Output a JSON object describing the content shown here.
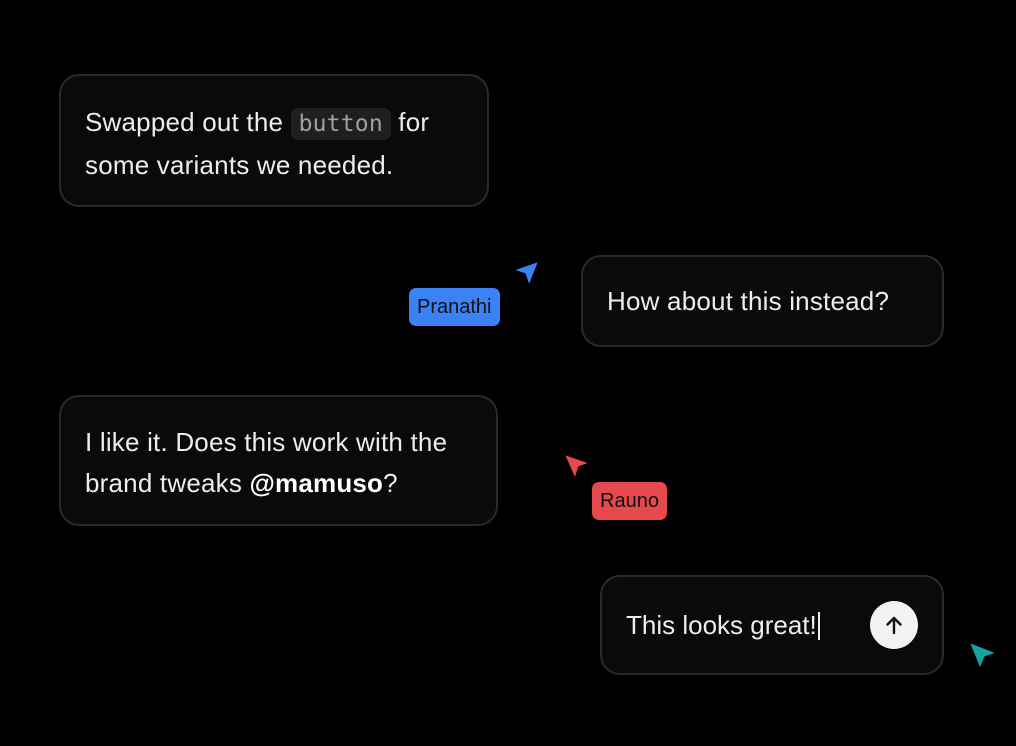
{
  "messages": [
    {
      "before_code": "Swapped out the ",
      "code": "button",
      "after_code": " for some variants we needed."
    },
    {
      "text": "How about this instead?"
    },
    {
      "before_mention": "I like it. Does this work with the brand tweaks ",
      "mention": "@mamuso",
      "after_mention": "?"
    }
  ],
  "composer": {
    "value": "This looks great!",
    "send_icon": "arrow-up-icon"
  },
  "cursors": [
    {
      "name": "Pranathi",
      "color": "#3b82f6"
    },
    {
      "name": "Rauno",
      "color": "#e5484d"
    },
    {
      "name": "",
      "color": "#14a3a0"
    }
  ]
}
